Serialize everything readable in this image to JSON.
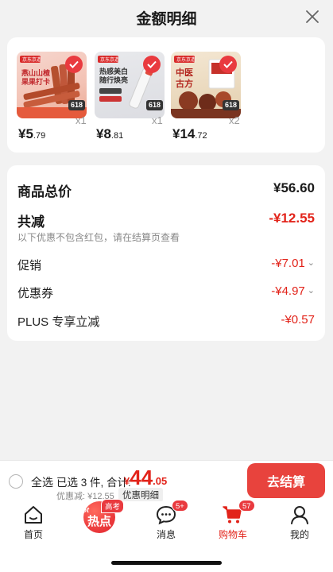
{
  "header": {
    "title": "金额明细"
  },
  "products": [
    {
      "price_int": "¥5",
      "price_dec": ".79",
      "qty": "x1",
      "badge": "618",
      "brand": "京东京造",
      "img_lines": [
        "燕山山楂",
        "果果打卡"
      ]
    },
    {
      "price_int": "¥8",
      "price_dec": ".81",
      "qty": "x1",
      "badge": "618",
      "brand": "京东京造",
      "img_lines": [
        "热感美白",
        "随行焕亮"
      ]
    },
    {
      "price_int": "¥14",
      "price_dec": ".72",
      "qty": "x2",
      "badge": "618",
      "brand": "京东京造",
      "img_lines": [
        "中医",
        "古方"
      ]
    }
  ],
  "summary": {
    "goods_total_label": "商品总价",
    "goods_total_value": "¥56.60",
    "total_reduce_label": "共减",
    "total_reduce_value": "-¥12.55",
    "note": "以下优惠不包含红包，请在结算页查看",
    "promo_label": "促销",
    "promo_value": "-¥7.01",
    "coupon_label": "优惠券",
    "coupon_value": "-¥4.97",
    "plus_label": "PLUS 专享立减",
    "plus_value": "-¥0.57"
  },
  "checkout": {
    "select_all": "全选",
    "selected_text": "已选 3 件, 合计:",
    "total_yen": "¥",
    "total_int": "44",
    "total_dec": ".05",
    "discount_line": "优惠减: ¥12.55",
    "detail_link": "优惠明细",
    "button": "去结算"
  },
  "tabbar": {
    "home": "首页",
    "hot_label": "热点",
    "hot_tag": "Hot",
    "hot_badge": "高考",
    "messages": "消息",
    "messages_badge": "5+",
    "cart": "购物车",
    "cart_badge": "57",
    "mine": "我的"
  },
  "colors": {
    "accent": "#e2231a",
    "button": "#e8433d"
  }
}
